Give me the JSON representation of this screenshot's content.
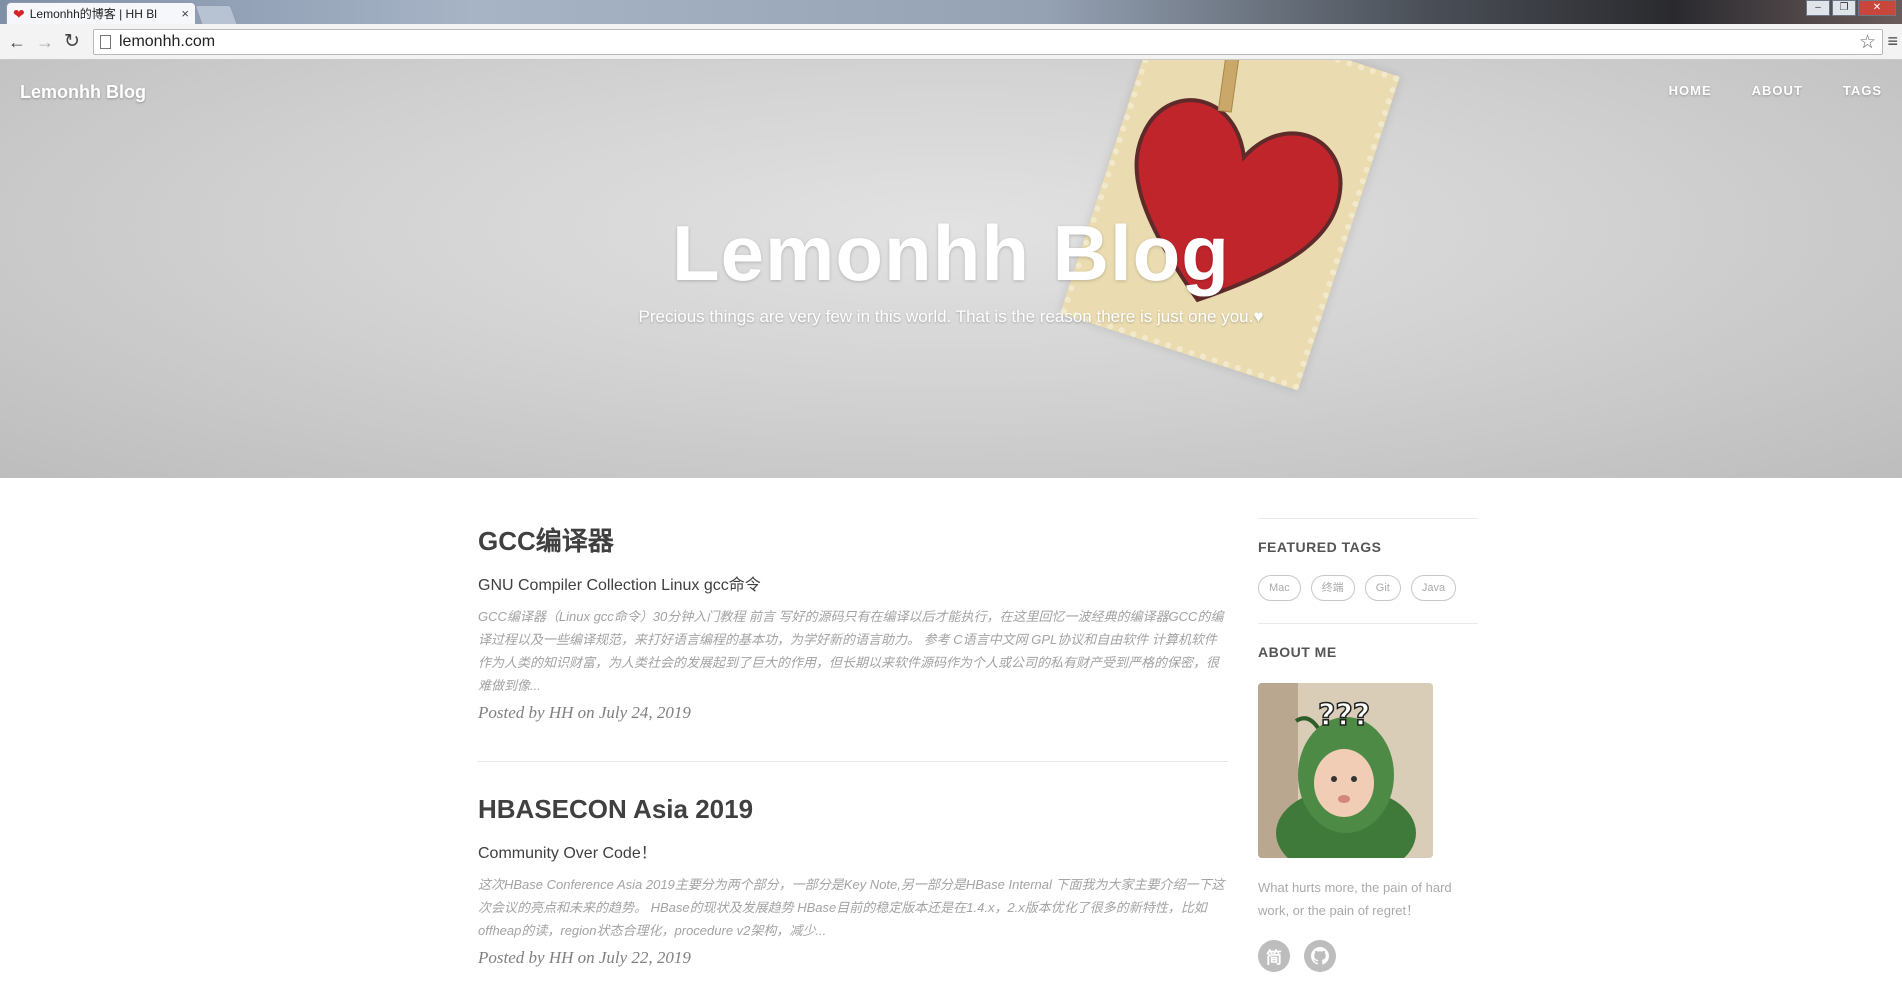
{
  "browser": {
    "tab_title": "Lemonhh的博客 | HH Bl",
    "tab_close": "×",
    "url": "lemonhh.com",
    "window_controls": [
      "–",
      "❐",
      "✕"
    ],
    "icons": [
      "heart-favicon",
      "back-arrow",
      "forward-arrow",
      "reload",
      "page-icon",
      "bookmark-star",
      "menu"
    ]
  },
  "site": {
    "brand": "Lemonhh Blog",
    "nav": [
      "HOME",
      "ABOUT",
      "TAGS"
    ],
    "hero_title": "Lemonhh Blog",
    "hero_subtitle": "Precious things are very few in this world. That is the reason there is just one you.♥"
  },
  "posts": [
    {
      "title": "GCC编译器",
      "subtitle": "GNU Compiler Collection Linux gcc命令",
      "excerpt": "GCC编译器（Linux gcc命令）30分钟入门教程 前言 写好的源码只有在编译以后才能执行，在这里回忆一波经典的编译器GCC的编译过程以及一些编译规范，来打好语言编程的基本功，为学好新的语言助力。 参考 C语言中文网 GPL协议和自由软件 计算机软件作为人类的知识财富，为人类社会的发展起到了巨大的作用，但长期以来软件源码作为个人或公司的私有财产受到严格的保密，很难做到像...",
      "meta": "Posted by HH on July 24, 2019"
    },
    {
      "title": "HBASECON Asia 2019",
      "subtitle": "Community Over Code！",
      "excerpt": "这次HBase Conference Asia 2019主要分为两个部分，一部分是Key Note,另一部分是HBase Internal 下面我为大家主要介绍一下这次会议的亮点和未来的趋势。 HBase的现状及发展趋势 HBase目前的稳定版本还是在1.4.x，2.x版本优化了很多的新特性，比如offheap的读，region状态合理化，procedure v2架构，减少...",
      "meta": "Posted by HH on July 22, 2019"
    }
  ],
  "sidebar": {
    "featured_tags_heading": "FEATURED TAGS",
    "tags": [
      "Mac",
      "终端",
      "Git",
      "Java"
    ],
    "about_heading": "ABOUT ME",
    "about_text": "What hurts more, the pain of hard work, or the pain of regret！",
    "social": [
      "简",
      "github"
    ]
  },
  "colors": {
    "heart": "#c0252c",
    "text": "#404040",
    "muted": "#a3a3a3"
  }
}
